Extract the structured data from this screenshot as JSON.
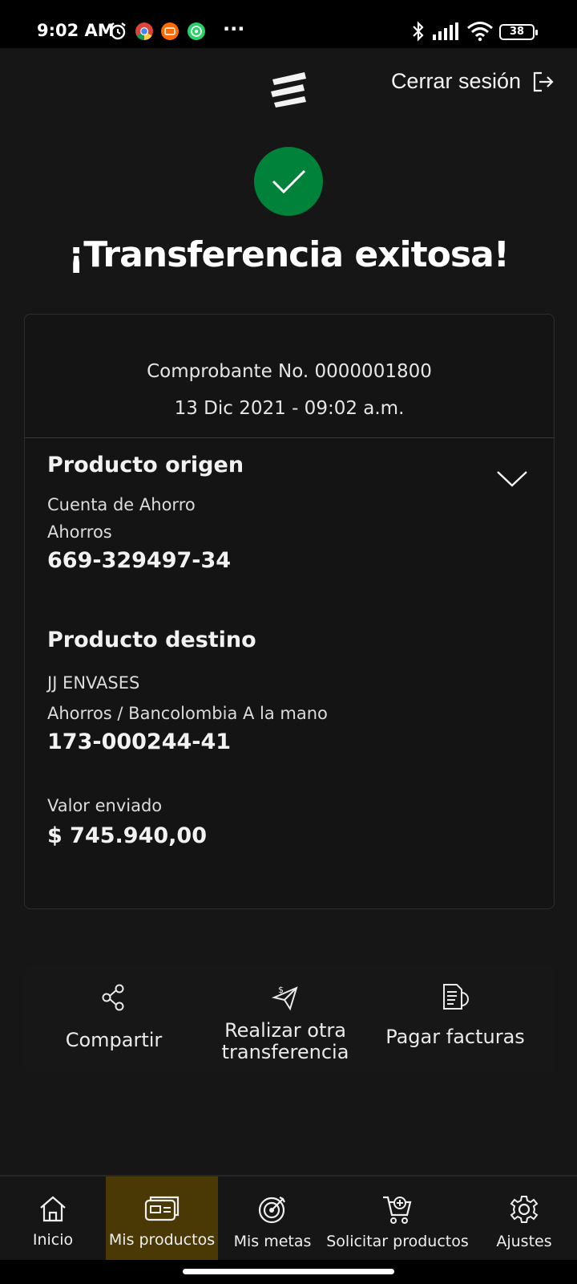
{
  "status_bar": {
    "time": "9:02 AM",
    "battery": "38",
    "overflow": "···"
  },
  "header": {
    "logout_label": "Cerrar sesión"
  },
  "success": {
    "title": "¡Transferencia exitosa!",
    "accent_color": "#00823a"
  },
  "receipt": {
    "voucher": "Comprobante No. 0000001800",
    "datetime": "13 Dic 2021 - 09:02 a.m.",
    "origin": {
      "title": "Producto origen",
      "account_type": "Cuenta de Ahorro",
      "sub_type": "Ahorros",
      "number": "669-329497-34"
    },
    "destination": {
      "title": "Producto destino",
      "name": "JJ ENVASES",
      "type": "Ahorros / Bancolombia A la mano",
      "number": "173-000244-41"
    },
    "amount_label": "Valor enviado",
    "amount": "$ 745.940,00"
  },
  "actions": {
    "share": "Compartir",
    "transfer_line1": "Realizar otra",
    "transfer_line2": "transferencia",
    "pay_bills": "Pagar facturas"
  },
  "bottom_nav": {
    "items": [
      {
        "label": "Inicio",
        "icon": "home-icon"
      },
      {
        "label": "Mis productos",
        "icon": "wallet-icon",
        "active": true
      },
      {
        "label": "Mis metas",
        "icon": "target-icon"
      },
      {
        "label": "Solicitar productos",
        "icon": "cart-icon"
      },
      {
        "label": "Ajustes",
        "icon": "gear-icon"
      }
    ],
    "active_color": "#4a3805"
  }
}
